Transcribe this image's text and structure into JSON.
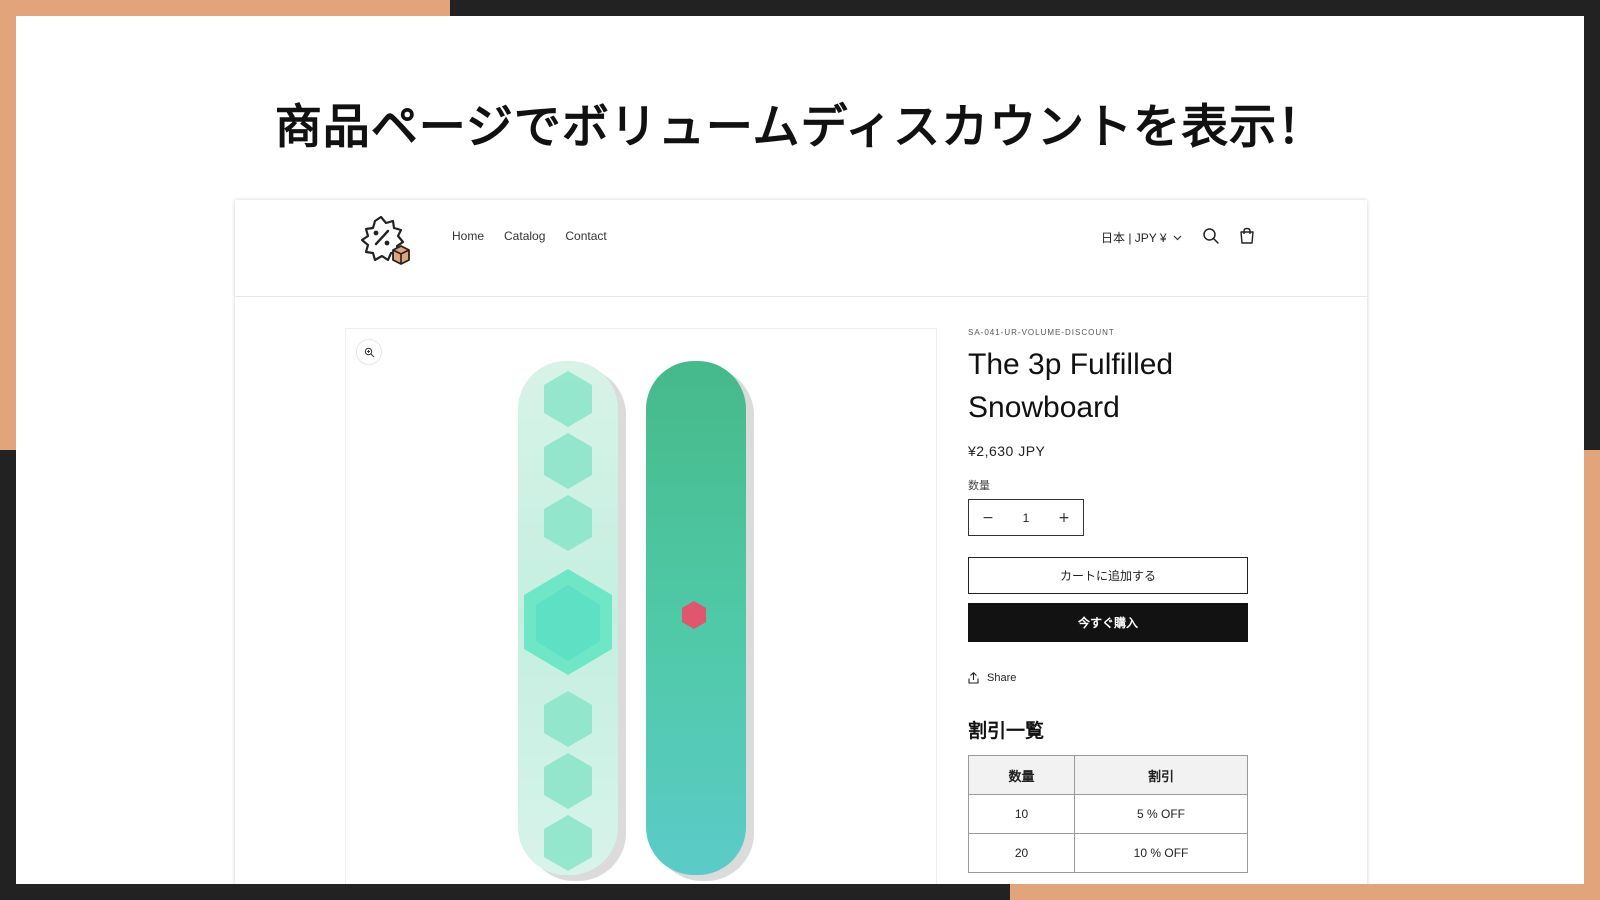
{
  "colors": {
    "accent_orange": "#E2A47A",
    "dark": "#222222",
    "buy_button": "#121212",
    "board_green": "#4CC9A5"
  },
  "headline": "商品ページでボリュームディスカウントを表示！",
  "header": {
    "logo_icon": "discount-badge-box-icon",
    "nav": [
      "Home",
      "Catalog",
      "Contact"
    ],
    "locale": "日本 | JPY ¥",
    "search_icon": "search-icon",
    "cart_icon": "cart-icon"
  },
  "product": {
    "sku": "SA-041-UR-VOLUME-DISCOUNT",
    "title": "The 3p Fulfilled Snowboard",
    "price": "¥2,630 JPY",
    "quantity_label": "数量",
    "quantity_value": "1",
    "minus": "−",
    "plus": "+",
    "add_to_cart": "カートに追加する",
    "buy_now": "今すぐ購入",
    "share": "Share"
  },
  "discount": {
    "title": "割引一覧",
    "headers": [
      "数量",
      "割引"
    ],
    "rows": [
      {
        "qty": "10",
        "discount": "5 % OFF"
      },
      {
        "qty": "20",
        "discount": "10 % OFF"
      }
    ]
  }
}
